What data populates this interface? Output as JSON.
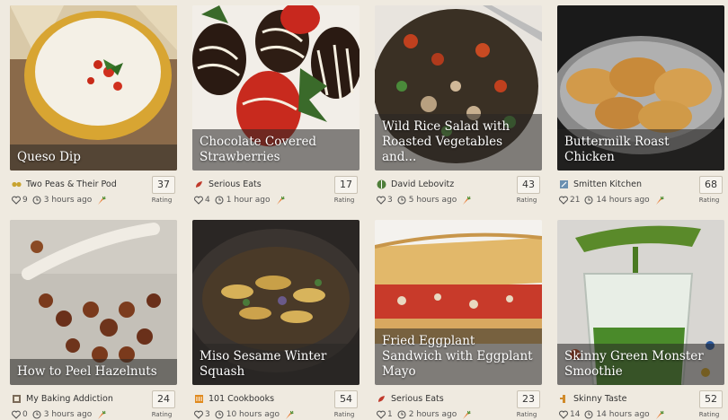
{
  "recipes": [
    {
      "title": "Queso Dip",
      "source": "Two Peas & Their Pod",
      "likes": "9",
      "time": "3 hours ago",
      "rating": "37",
      "rating_label": "Rating",
      "source_icon": "two-peas-icon",
      "source_color": "#c8a431"
    },
    {
      "title": "Chocolate Covered Strawberries",
      "source": "Serious Eats",
      "likes": "4",
      "time": "1 hour ago",
      "rating": "17",
      "rating_label": "Rating",
      "source_icon": "serious-eats-icon",
      "source_color": "#c0392b"
    },
    {
      "title": "Wild Rice Salad with Roasted Vegetables and...",
      "source": "David Lebovitz",
      "likes": "3",
      "time": "5 hours ago",
      "rating": "43",
      "rating_label": "Rating",
      "source_icon": "david-lebovitz-icon",
      "source_color": "#4f7f3a"
    },
    {
      "title": "Buttermilk Roast Chicken",
      "source": "Smitten Kitchen",
      "likes": "21",
      "time": "14 hours ago",
      "rating": "68",
      "rating_label": "Rating",
      "source_icon": "smitten-kitchen-icon",
      "source_color": "#6a8fb0"
    },
    {
      "title": "How to Peel Hazelnuts",
      "source": "My Baking Addiction",
      "likes": "0",
      "time": "3 hours ago",
      "rating": "24",
      "rating_label": "Rating",
      "source_icon": "my-baking-addiction-icon",
      "source_color": "#7a6a58"
    },
    {
      "title": "Miso Sesame Winter Squash",
      "source": "101 Cookbooks",
      "likes": "3",
      "time": "10 hours ago",
      "rating": "54",
      "rating_label": "Rating",
      "source_icon": "101-cookbooks-icon",
      "source_color": "#e08a1e"
    },
    {
      "title": "Fried Eggplant Sandwich with Eggplant Mayo",
      "source": "Serious Eats",
      "likes": "1",
      "time": "2 hours ago",
      "rating": "23",
      "rating_label": "Rating",
      "source_icon": "serious-eats-icon",
      "source_color": "#c0392b"
    },
    {
      "title": "Skinny Green Monster Smoothie",
      "source": "Skinny Taste",
      "likes": "14",
      "time": "14 hours ago",
      "rating": "52",
      "rating_label": "Rating",
      "source_icon": "skinny-taste-icon",
      "source_color": "#d08a2a"
    }
  ],
  "colors": {
    "carrot": "#e8742a",
    "heart": "#555555",
    "background": "#efeae0"
  }
}
